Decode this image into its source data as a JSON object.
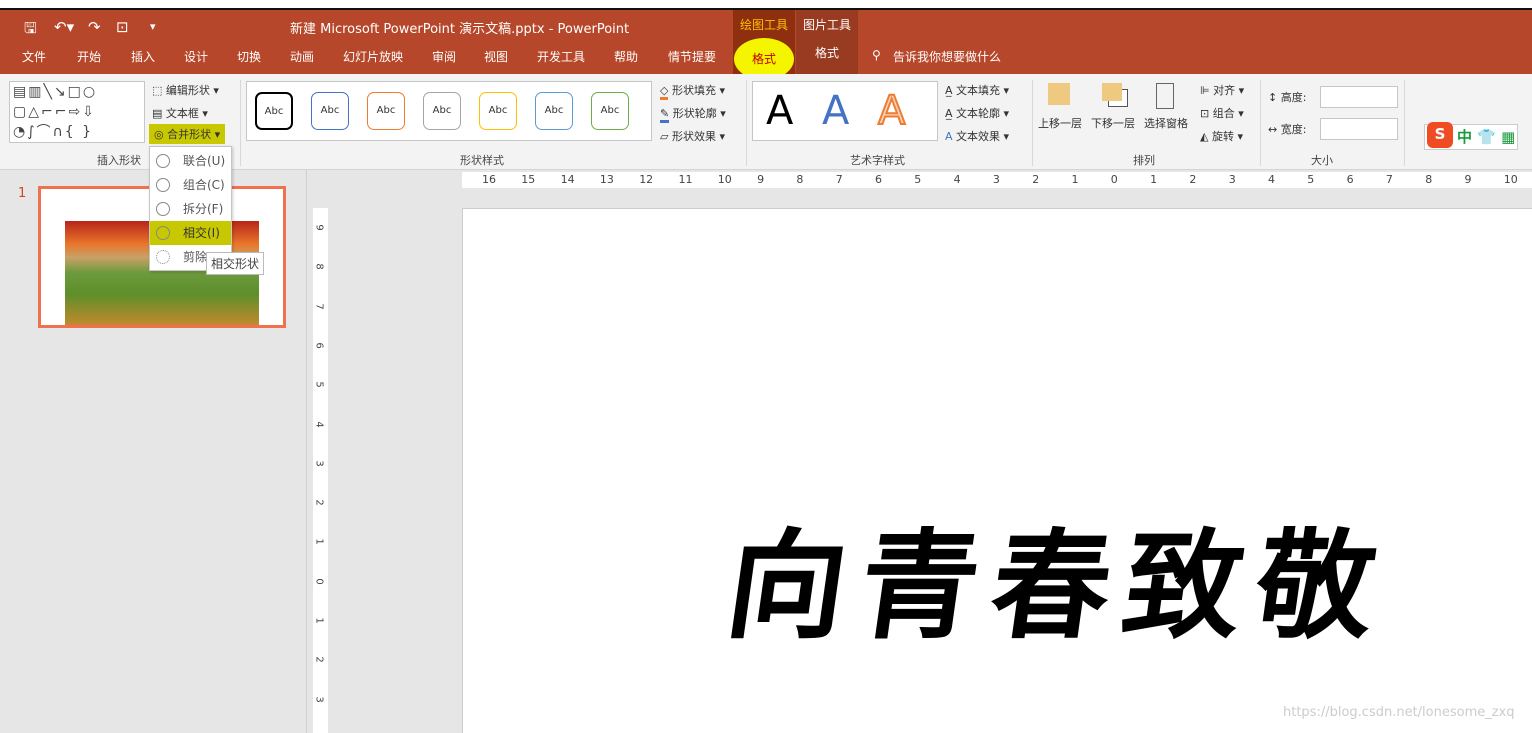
{
  "window": {
    "title": "新建 Microsoft PowerPoint 演示文稿.pptx  -  PowerPoint"
  },
  "quick_access": [
    "save-icon",
    "undo-icon",
    "redo-icon",
    "slideshow-from-start-icon",
    "customize-icon"
  ],
  "context_tabs": [
    {
      "group": "绘图工具",
      "tab": "格式",
      "active": true
    },
    {
      "group": "图片工具",
      "tab": "格式"
    }
  ],
  "tabs": [
    "文件",
    "开始",
    "插入",
    "设计",
    "切换",
    "动画",
    "幻灯片放映",
    "审阅",
    "视图",
    "开发工具",
    "帮助",
    "情节提要"
  ],
  "tell_me": "告诉我你想要做什么",
  "ribbon": {
    "insert_shapes": {
      "label": "插入形状",
      "edit_shape": "编辑形状",
      "text_box": "文本框",
      "merge_shapes": "合并形状"
    },
    "shape_styles": {
      "label": "形状样式",
      "preset": "Abc",
      "preset_colors": [
        "#000000",
        "#4472c4",
        "#ed7d31",
        "#a5a5a5",
        "#ffc000",
        "#5b9bd5",
        "#70ad47"
      ],
      "fill": "形状填充",
      "outline": "形状轮廓",
      "effects": "形状效果"
    },
    "wordart": {
      "label": "艺术字样式",
      "sample": "A",
      "sample_colors": [
        "#000000",
        "#4472c4",
        "#ed7d31"
      ],
      "fill": "文本填充",
      "outline": "文本轮廓",
      "effects": "文本效果"
    },
    "arrange": {
      "label": "排列",
      "forward": "上移一层",
      "backward": "下移一层",
      "pane": "选择窗格",
      "align": "对齐",
      "group": "组合",
      "rotate": "旋转"
    },
    "size": {
      "label": "大小",
      "height": "高度:",
      "width": "宽度:",
      "height_value": "",
      "width_value": ""
    }
  },
  "ime": {
    "label": "中"
  },
  "merge_menu": {
    "items": [
      "联合(U)",
      "组合(C)",
      "拆分(F)",
      "相交(I)",
      "剪除"
    ],
    "highlighted": "相交(I)",
    "tooltip": "相交形状"
  },
  "slides": {
    "number": "1"
  },
  "hruler": [
    "16",
    "15",
    "14",
    "13",
    "12",
    "11",
    "10",
    "9",
    "8",
    "7",
    "6",
    "5",
    "4",
    "3",
    "2",
    "1",
    "0",
    "1",
    "2",
    "3",
    "4",
    "5",
    "6",
    "7",
    "8",
    "9",
    "10"
  ],
  "vruler": [
    "9",
    "8",
    "7",
    "6",
    "5",
    "4",
    "3",
    "2",
    "1",
    "0",
    "1",
    "2",
    "3"
  ],
  "slide": {
    "art_text": "向青春致敬"
  },
  "watermark": "https://blog.csdn.net/lonesome_zxq",
  "colors": {
    "accent": "#b7472a",
    "highlight": "#f5f500"
  }
}
